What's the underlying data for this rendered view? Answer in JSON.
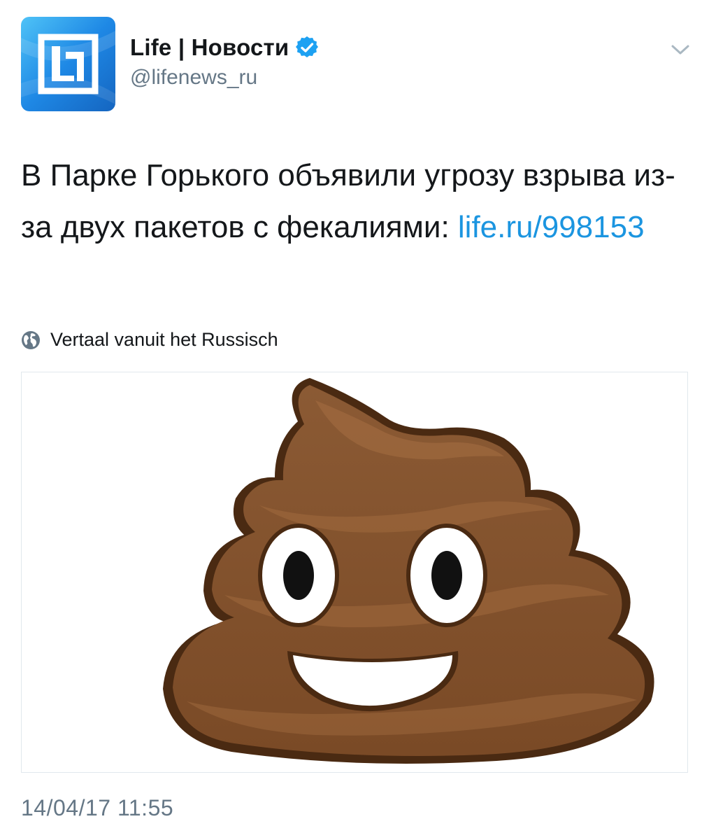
{
  "author": {
    "display_name": "Life | Новости",
    "handle": "@lifenews_ru",
    "avatar_icon": "life-logo-icon",
    "verified_icon": "verified-badge-icon"
  },
  "menu": {
    "icon": "chevron-down-icon"
  },
  "tweet": {
    "text": "В Парке Горького объявили угрозу взрыва из-за двух пакетов с фекалиями:",
    "link_text": "life.ru/998153",
    "translate_label": "Vertaal vanuit het Russisch",
    "translate_icon": "globe-icon",
    "media_description_icon": "pile-of-poo-emoji-icon",
    "timestamp": "14/04/17 11:55"
  },
  "colors": {
    "link": "#1b95e0",
    "muted": "#657786",
    "verified": "#1da1f2",
    "brand": "#1e88e5"
  }
}
